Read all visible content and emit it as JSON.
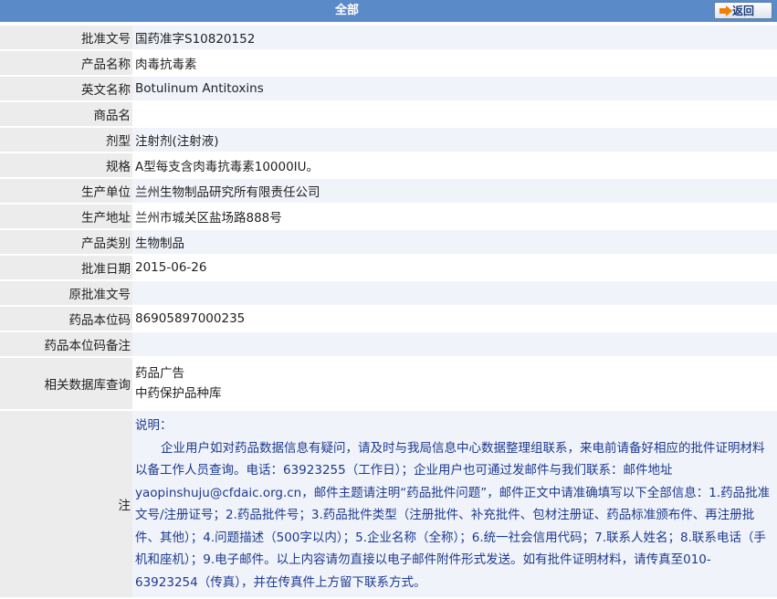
{
  "header": {
    "title": "全部",
    "back_label": "返回"
  },
  "rows": [
    {
      "label": "批准文号",
      "value": "国药准字S10820152"
    },
    {
      "label": "产品名称",
      "value": "肉毒抗毒素"
    },
    {
      "label": "英文名称",
      "value": "Botulinum Antitoxins"
    },
    {
      "label": "商品名",
      "value": ""
    },
    {
      "label": "剂型",
      "value": "注射剂(注射液)"
    },
    {
      "label": "规格",
      "value": "A型每支含肉毒抗毒素10000IU。"
    },
    {
      "label": "生产单位",
      "value": "兰州生物制品研究所有限责任公司"
    },
    {
      "label": "生产地址",
      "value": "兰州市城关区盐场路888号"
    },
    {
      "label": "产品类别",
      "value": "生物制品"
    },
    {
      "label": "批准日期",
      "value": "2015-06-26"
    },
    {
      "label": "原批准文号",
      "value": ""
    },
    {
      "label": "药品本位码",
      "value": "86905897000235"
    },
    {
      "label": "药品本位码备注",
      "value": ""
    }
  ],
  "related": {
    "label": "相关数据库查询",
    "links": [
      "药品广告",
      "中药保护品种库"
    ]
  },
  "note": {
    "label": "注",
    "heading": "说明：",
    "body": "企业用户如对药品数据信息有疑问，请及时与我局信息中心数据整理组联系，来电前请备好相应的批件证明材料以备工作人员查询。电话：63923255（工作日）；企业用户也可通过发邮件与我们联系：邮件地址yaopinshuju@cfdaic.org.cn，邮件主题请注明“药品批件问题”，邮件正文中请准确填写以下全部信息：1.药品批准文号/注册证号；2.药品批件号；3.药品批件类型（注册批件、补充批件、包材注册证、药品标准颁布件、再注册批件、其他）；4.问题描述（500字以内）；5.企业名称（全称）；6.统一社会信用代码；7.联系人姓名；8.联系电话（手机和座机）；9.电子邮件。以上内容请勿直接以电子邮件附件形式发送。如有批件证明材料，请传真至010-63923254（传真），并在传真件上方留下联系方式。"
  },
  "colors": {
    "header_bg": "#5b8ac9",
    "label_bg": "#ececec",
    "row_alt_bg": "#f0f3f9",
    "note_text": "#1d3a8f",
    "arrow": "#ef7f00"
  }
}
